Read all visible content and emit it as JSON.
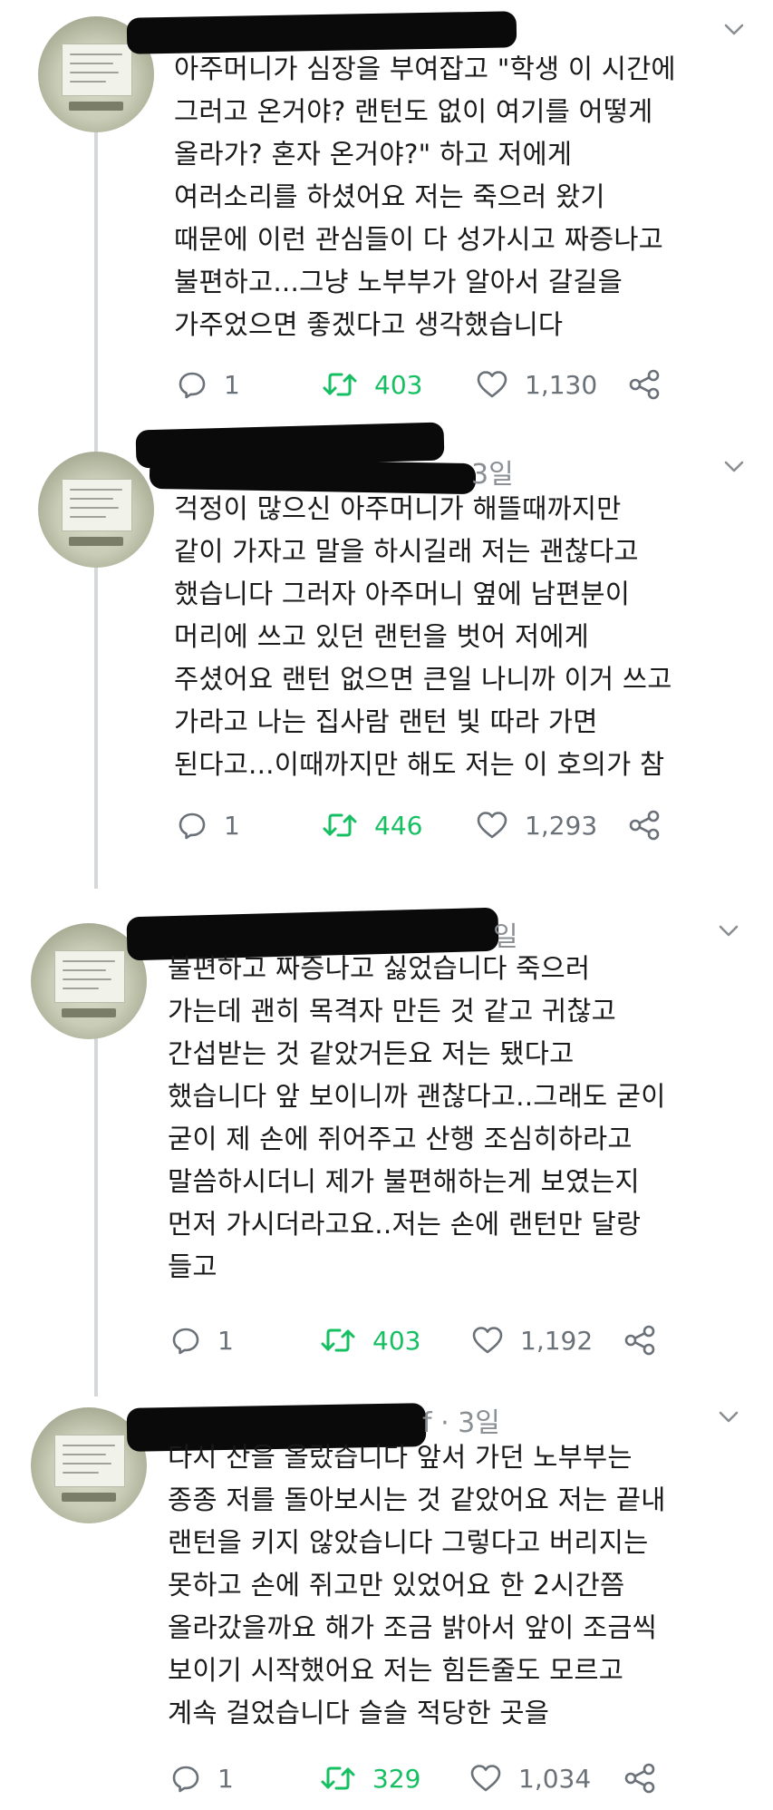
{
  "tweets": [
    {
      "meta_visible": "",
      "lines": [
        "아주머니가 심장을 부여잡고 \"학생 이 시간에",
        "그러고 온거야? 랜턴도 없이 여기를 어떻게",
        "올라가? 혼자 온거야?\" 하고 저에게",
        "여러소리를 하셨어요 저는 죽으러 왔기",
        "때문에 이런 관심들이 다 성가시고 짜증나고",
        "불편하고...그냥 노부부가 알아서 갈길을",
        "가주었으면 좋겠다고 생각했습니다"
      ],
      "replies": "1",
      "retweets": "403",
      "likes": "1,130"
    },
    {
      "meta_visible": "3일",
      "lines": [
        "걱정이 많으신 아주머니가 해뜰때까지만",
        "같이 가자고 말을 하시길래 저는 괜찮다고",
        "했습니다 그러자 아주머니 옆에 남편분이",
        "머리에 쓰고 있던 랜턴을 벗어 저에게",
        "주셨어요 랜턴 없으면 큰일 나니까 이거 쓰고",
        "가라고 나는 집사람 랜턴 빛 따라 가면",
        "된다고...이때까지만 해도 저는 이 호의가 참"
      ],
      "replies": "1",
      "retweets": "446",
      "likes": "1,293"
    },
    {
      "meta_visible": "일",
      "lines": [
        "불편하고 짜증나고 싫었습니다 죽으러",
        "가는데 괜히 목격자 만든 것 같고 귀찮고",
        "간섭받는 것 같았거든요 저는 됐다고",
        "했습니다 앞 보이니까 괜찮다고..그래도 굳이",
        "굳이 제 손에 쥐어주고 산행 조심히하라고",
        "말씀하시더니 제가 불편해하는게 보였는지",
        "먼저 가시더라고요..저는 손에 랜턴만 달랑",
        "들고"
      ],
      "replies": "1",
      "retweets": "403",
      "likes": "1,192"
    },
    {
      "meta_visible": "f · 3일",
      "lines": [
        "다시 산을 올랐습니다 앞서 가던 노부부는",
        "종종 저를 돌아보시는 것 같았어요 저는 끝내",
        "랜턴을 키지 않았습니다 그렇다고 버리지는",
        "못하고 손에 쥐고만 있었어요 한 2시간쯤",
        "올라갔을까요 해가 조금 밝아서 앞이 조금씩",
        "보이기 시작했어요 저는 힘든줄도 모르고",
        "계속 걸었습니다 슬슬 적당한 곳을"
      ],
      "replies": "1",
      "retweets": "329",
      "likes": "1,034"
    }
  ],
  "icons": {
    "reply": "reply-icon",
    "retweet": "retweet-icon",
    "like": "heart-icon",
    "share": "share-icon",
    "menu": "chevron-down-icon"
  },
  "colors": {
    "retweet_active": "#17bf63",
    "meta": "#8a8f94",
    "thread_line": "#d4d8db",
    "redaction": "#0a0a0a"
  }
}
